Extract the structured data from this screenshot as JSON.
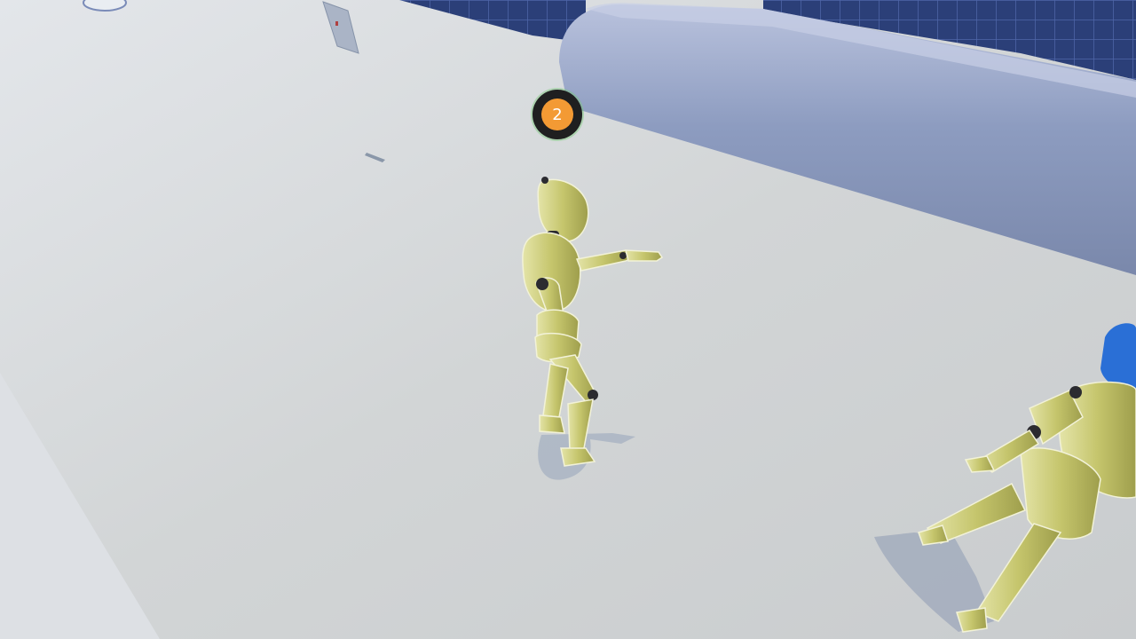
{
  "hud": {
    "player_marker": {
      "number": "2",
      "icon": "player-number-badge",
      "fill_color": "#f39a34",
      "ring_color": "#1f1f20"
    }
  },
  "scene": {
    "floor_color": "#cfd3d6",
    "wall_color": "#8c9bbd",
    "grid_color": "#2f4a8c",
    "mannequin_color": "#c9c971",
    "accent_blue": "#2a6fd6"
  }
}
